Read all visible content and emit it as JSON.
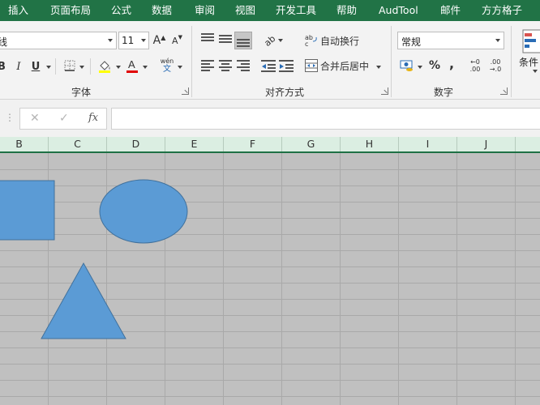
{
  "tabs": [
    "插入",
    "页面布局",
    "公式",
    "数据",
    "审阅",
    "视图",
    "开发工具",
    "帮助",
    "AudTool",
    "邮件",
    "方方格子"
  ],
  "font": {
    "name_value": "等线",
    "size_value": "11",
    "grow_label": "A",
    "shrink_label": "A",
    "underline_label": "U",
    "phonetic_top": "wén",
    "phonetic_bottom": "文",
    "group_label": "字体"
  },
  "alignment": {
    "wrap_text_label": "自动换行",
    "merge_center_label": "合并后居中",
    "orientation_text": "ab",
    "group_label": "对齐方式"
  },
  "number": {
    "format_value": "常规",
    "percent_label": "%",
    "comma_label": ",",
    "inc_decimal_top": "←0",
    "inc_decimal_bottom": ".00",
    "dec_decimal_top": ".00",
    "dec_decimal_bottom": "→.0",
    "group_label": "数字"
  },
  "styles": {
    "conditional_label": "条件"
  },
  "formula_bar": {
    "cancel_symbol": "✕",
    "enter_symbol": "✓",
    "fx_label": "fx",
    "value": ""
  },
  "columns": [
    "B",
    "C",
    "D",
    "E",
    "F",
    "G",
    "H",
    "I",
    "J"
  ],
  "colors": {
    "ribbon_green": "#217346",
    "shape_fill": "#5b9bd5",
    "shape_stroke": "#41719c",
    "grid_background": "#c0c0c0",
    "font_color_bar": "#e00000",
    "highlight_bar": "#ffff00"
  },
  "shapes": [
    {
      "name": "rectangle",
      "color": "#5b9bd5"
    },
    {
      "name": "oval",
      "color": "#5b9bd5"
    },
    {
      "name": "triangle",
      "color": "#5b9bd5"
    }
  ]
}
